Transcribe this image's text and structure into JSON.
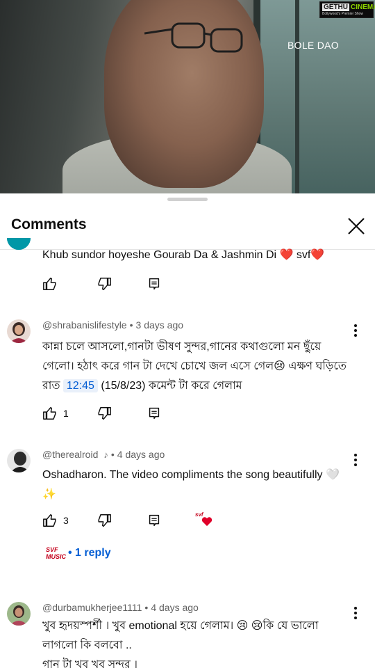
{
  "video": {
    "title": "BOLE DAO",
    "watermark": {
      "main_a": "GETHU",
      "main_b": "CINEMA",
      "sub": "Bollywood's Premier Show"
    }
  },
  "sheet": {
    "title": "Comments",
    "close_icon": "close-icon"
  },
  "comments": [
    {
      "text": "Khub sundor hoyeshe Gourab Da & Jashmin Di ❤️ svf❤️",
      "likes": ""
    },
    {
      "handle": "@shrabanislifestyle",
      "age": "3 days ago",
      "text_before": "কান্না চলে আসলো,গানটা ভীষণ সুন্দর,গানের কথাগুলো মন ছুঁয়ে গেলো। হঠাৎ করে গান টা দেখে চোখে জল এসে গেল😢 এক্ষণ ঘড়িতে রাত ",
      "timestamp": "12:45",
      "text_after": " (15/8/23) কমেন্ট টা করে গেলাম",
      "likes": "1"
    },
    {
      "handle": "@therealroid",
      "age": "4 days ago",
      "text": "Oshadharon. The video compliments the song beautifully 🤍✨",
      "likes": "3",
      "creator_heart_label": "svf"
    },
    {
      "reply_avatar_label": "SVF MUSIC",
      "reply_label": "• 1 reply"
    },
    {
      "handle": "@durbamukherjee1111",
      "age": "4 days ago",
      "text": "খুব হৃদয়স্পর্শী । খুব emotional হয়ে গেলাম। 😢 😢কি যে ভালো লাগলো কি বলবো ..\nগান টা খুব খুব সুন্দর ।"
    }
  ],
  "colors": {
    "link": "#065fd4",
    "muted": "#606060",
    "heart": "#e0002a"
  }
}
